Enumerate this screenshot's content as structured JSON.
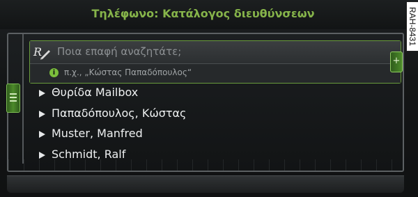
{
  "header": {
    "title": "Τηλέφωνο: Κατάλογος διευθύνσεων"
  },
  "search": {
    "placeholder": "Ποια επαφή αναζητάτε;",
    "hint": "π.χ., „Κώστας Παπαδόπουλος“"
  },
  "contacts": [
    {
      "label": "Θυρίδα Mailbox"
    },
    {
      "label": "Παπαδόπουλος, Κώστας"
    },
    {
      "label": "Muster, Manfred"
    },
    {
      "label": "Schmidt, Ralf"
    }
  ],
  "side_add_label": "+",
  "figure_code": "RAH-8431",
  "colors": {
    "accent": "#86b44a",
    "text": "#eef0f1",
    "background": "#141617"
  },
  "icons": [
    "handwriting-search-icon",
    "info-icon",
    "menu-icon",
    "add-icon",
    "arrow-right-icon"
  ]
}
